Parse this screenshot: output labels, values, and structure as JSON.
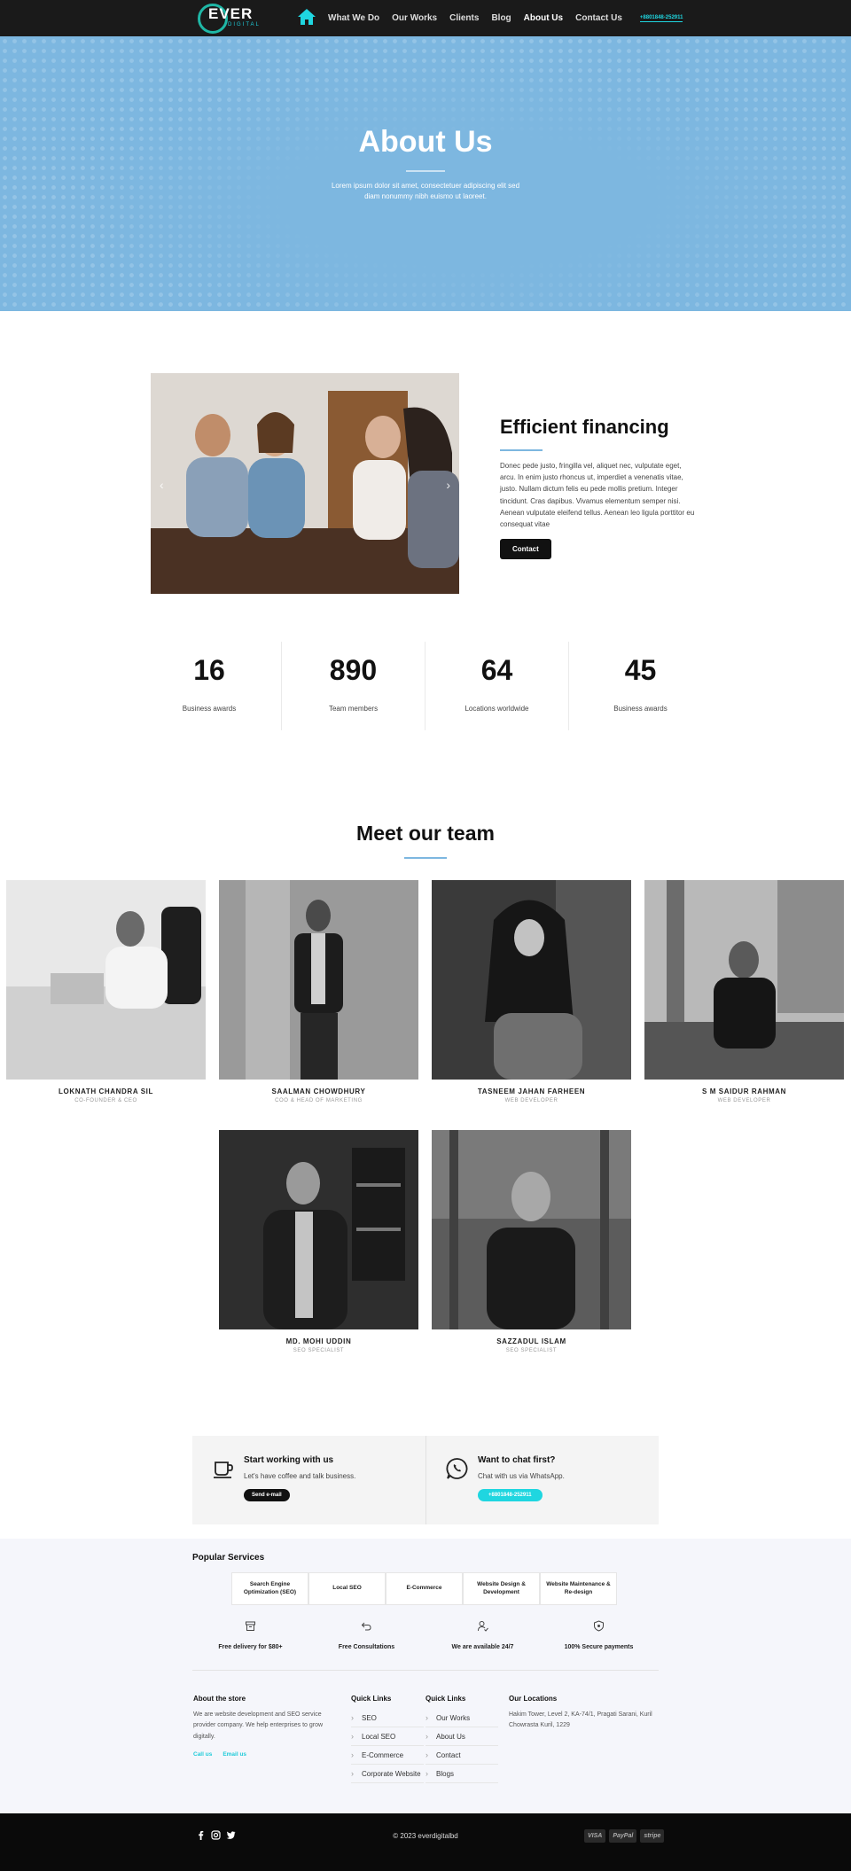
{
  "nav": {
    "logo_text": "EVER",
    "logo_sub": "DIGITAL",
    "links": [
      "What We Do",
      "Our Works",
      "Clients",
      "Blog",
      "About Us",
      "Contact Us"
    ],
    "phone": "+8801848-252911"
  },
  "hero": {
    "title": "About Us",
    "subtitle": "Lorem ipsum dolor sit amet, consectetuer adipiscing elit sed diam nonummy nibh euismo ut laoreet."
  },
  "financing": {
    "title": "Efficient financing",
    "body": "Donec pede justo, fringilla vel, aliquet nec, vulputate eget, arcu. In enim justo rhoncus ut, imperdiet a venenatis vitae, justo. Nullam dictum felis eu pede mollis pretium. Integer tincidunt. Cras dapibus. Vivamus elementum semper nisi. Aenean vulputate eleifend tellus. Aenean leo ligula porttitor eu consequat vitae",
    "button": "Contact",
    "prev": "‹",
    "next": "›"
  },
  "stats": [
    {
      "num": "16",
      "label": "Business awards"
    },
    {
      "num": "890",
      "label": "Team members"
    },
    {
      "num": "64",
      "label": "Locations worldwide"
    },
    {
      "num": "45",
      "label": "Business awards"
    }
  ],
  "team": {
    "title": "Meet our team",
    "members": [
      {
        "name": "LOKNATH CHANDRA SIL",
        "role": "CO-FOUNDER & CEO"
      },
      {
        "name": "SAALMAN CHOWDHURY",
        "role": "COO & HEAD OF MARKETING"
      },
      {
        "name": "TASNEEM JAHAN FARHEEN",
        "role": "WEB DEVELOPER"
      },
      {
        "name": "S M SAIDUR RAHMAN",
        "role": "WEB DEVELOPER"
      },
      {
        "name": "MD. MOHI UDDIN",
        "role": "SEO SPECIALIST"
      },
      {
        "name": "SAZZADUL ISLAM",
        "role": "SEO SPECIALIST"
      }
    ]
  },
  "cta": {
    "work_title": "Start working with us",
    "work_sub": "Let's have coffee and talk business.",
    "work_button": "Send e-mail",
    "chat_title": "Want to chat first?",
    "chat_sub": "Chat with us via WhatsApp.",
    "chat_button": "+8801848-252911"
  },
  "footer": {
    "popular_title": "Popular Services",
    "services": [
      "Search Engine Optimization (SEO)",
      "Local SEO",
      "E-Commerce",
      "Website Design & Development",
      "Website Maintenance & Re-design"
    ],
    "features": [
      "Free delivery for $80+",
      "Free Consultations",
      "We are available 24/7",
      "100% Secure payments"
    ],
    "about_title": "About the store",
    "about_body": "We are website development and SEO service provider company. We help enterprises to grow digitally.",
    "call": "Call us",
    "email": "Email us",
    "quick1_title": "Quick Links",
    "quick1": [
      "SEO",
      "Local SEO",
      "E-Commerce",
      "Corporate Website"
    ],
    "quick2_title": "Quick Links",
    "quick2": [
      "Our Works",
      "About Us",
      "Contact",
      "Blogs"
    ],
    "loc_title": "Our Locations",
    "loc_body": "Hakim Tower, Level 2, KA-74/1, Pragati Sarani, Kuril Chowrasta Kuril, 1229"
  },
  "bottom": {
    "copyright": "© 2023 everdigitalbd",
    "payments": [
      "VISA",
      "PayPal",
      "stripe"
    ]
  },
  "colors": {
    "accent": "#1fd6e0",
    "hero": "#7db7e0",
    "dark": "#1a1a1a"
  }
}
